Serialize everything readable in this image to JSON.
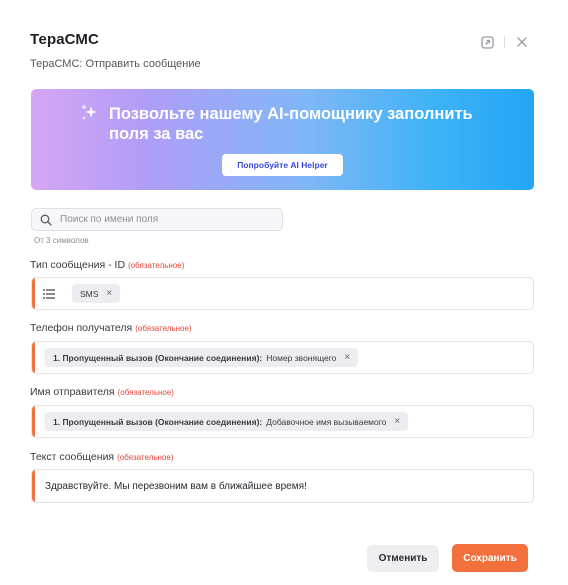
{
  "dialog": {
    "title": "ТераСМС",
    "subtitle": "ТераСМС: Отправить сообщение",
    "icons": [
      "open-external-icon",
      "close-icon"
    ]
  },
  "ai_banner": {
    "title": "Позвольте нашему AI-помощнику заполнить поля за вас",
    "button_label": "Попробуйте AI Helper",
    "icon": "sparkle-icon"
  },
  "search": {
    "placeholder": "Поиск по имени поля",
    "hint": "От 3 символов",
    "icon": "search-icon"
  },
  "fields": {
    "message_type": {
      "label": "Тип сообщения - ID",
      "required": "(обязательное)",
      "chip": "SMS",
      "icon": "list-icon"
    },
    "recipient_phone": {
      "label": "Телефон получателя",
      "required": "(обязательное)",
      "chip_bold": "1. Пропущенный вызов (Окончание соединения):",
      "chip_value": "Номер звонящего"
    },
    "sender_name": {
      "label": "Имя отправителя",
      "required": "(обязательное)",
      "chip_bold": "1. Пропущенный вызов (Окончание соединения):",
      "chip_value": "Добавочное имя вызываемого"
    },
    "message_text": {
      "label": "Текст сообщения",
      "required": "(обязательное)",
      "value": "Здравствуйте. Мы перезвоним вам в ближайшее время!"
    }
  },
  "footer": {
    "cancel_label": "Отменить",
    "save_label": "Сохранить"
  },
  "colors": {
    "accent": "#f2703b",
    "required": "#e5443a",
    "ai_button_text": "#3a4bd8"
  }
}
